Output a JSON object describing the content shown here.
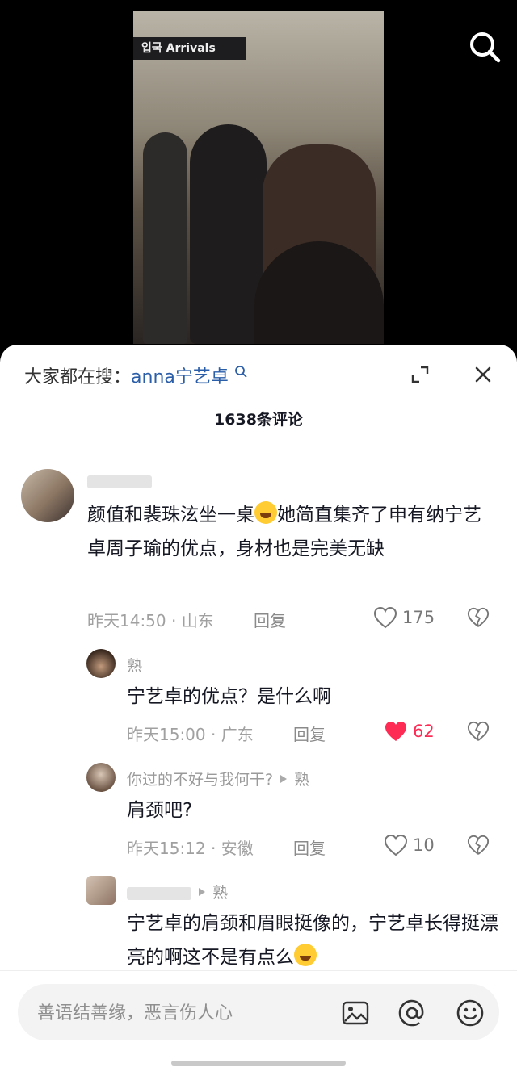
{
  "video": {
    "sign_text": "입국 Arrivals"
  },
  "search_icon": "search-icon",
  "sheet": {
    "hot_label": "大家都在搜：",
    "hot_keyword": "anna宁艺卓",
    "count": "1638条评论"
  },
  "comments": [
    {
      "user": "",
      "text": "颜值和裴珠泫坐一桌",
      "text2": "她简直集齐了申有纳宁艺卓周子瑜的优点，身材也是完美无缺",
      "time": "昨天14:50",
      "sep": "·",
      "region": "山东",
      "reply": "回复",
      "likes": "175",
      "liked": false
    },
    {
      "user": "熟",
      "text": "宁艺卓的优点？是什么啊",
      "time": "昨天15:00",
      "sep": "·",
      "region": "广东",
      "reply": "回复",
      "likes": "62",
      "liked": true
    },
    {
      "user": "你过的不好与我何干?",
      "reply_to": "熟",
      "text": "肩颈吧?",
      "time": "昨天15:12",
      "sep": "·",
      "region": "安徽",
      "reply": "回复",
      "likes": "10",
      "liked": false
    },
    {
      "user": "",
      "reply_to": "熟",
      "text": "宁艺卓的肩颈和眉眼挺像的，宁艺卓长得挺漂亮的啊这不是有点么"
    }
  ],
  "input": {
    "placeholder": "善语结善缘，恶言伤人心"
  },
  "colors": {
    "like_active": "#fe2c55",
    "keyword": "#2b5ea8"
  }
}
